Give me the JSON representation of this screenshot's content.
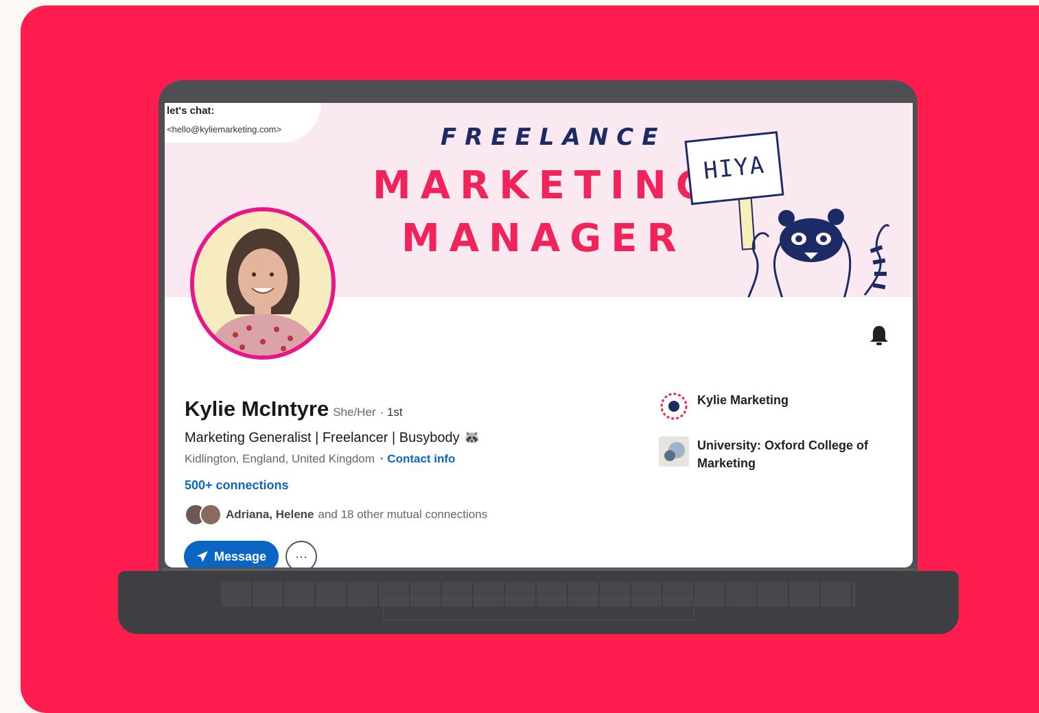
{
  "colors": {
    "backdrop": "#ff1d4e",
    "linkedin_blue": "#0a66c2",
    "banner_bg": "#fbe9f1",
    "accent_pink": "#f0245a",
    "navy": "#1c2a66"
  },
  "banner": {
    "chat_title": "let's chat:",
    "chat_email": "<hello@kyliemarketing.com>",
    "line1": "FREELANCE",
    "line2": "MARKETING",
    "line3": "MANAGER",
    "sign_text": "HIYA"
  },
  "profile": {
    "name": "Kylie McIntyre",
    "pronouns": "She/Her",
    "degree": "· 1st",
    "headline": "Marketing Generalist | Freelancer | Busybody 🦝",
    "location": "Kidlington, England, United Kingdom",
    "contact_info": "· Contact info",
    "connections": "500+ connections",
    "mutual_names": "Adriana, Helene",
    "mutual_rest": "and 18 other mutual connections"
  },
  "actions": {
    "message_label": "Message",
    "more_label": "···"
  },
  "sidebar": {
    "company": "Kylie Marketing",
    "education": "University: Oxford College of Marketing"
  },
  "icons": {
    "bell": "bell-icon",
    "send": "send-icon",
    "more": "more-icon"
  }
}
